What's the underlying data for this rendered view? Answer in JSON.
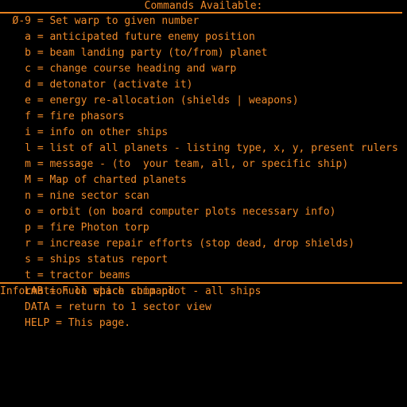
{
  "screen": {
    "title": "Commands Available:",
    "background_color": "#000000",
    "text_color": "#f08a2a",
    "rule_color": "#e8821f"
  },
  "commands": [
    {
      "key": "Ø-9",
      "sep": " = ",
      "desc": "Set warp to given number",
      "wide": false
    },
    {
      "key": "a",
      "sep": " = ",
      "desc": "anticipated future enemy position",
      "wide": false
    },
    {
      "key": "b",
      "sep": " = ",
      "desc": "beam landing party (to/from) planet",
      "wide": false
    },
    {
      "key": "c",
      "sep": " = ",
      "desc": "change course heading and warp",
      "wide": false
    },
    {
      "key": "d",
      "sep": " = ",
      "desc": "detonator (activate it)",
      "wide": false
    },
    {
      "key": "e",
      "sep": " = ",
      "desc": "energy re-allocation (shields | weapons)",
      "wide": false
    },
    {
      "key": "f",
      "sep": " = ",
      "desc": "fire phasors",
      "wide": false
    },
    {
      "key": "i",
      "sep": " = ",
      "desc": "info on other ships",
      "wide": false
    },
    {
      "key": "l",
      "sep": " = ",
      "desc": "list of all planets - listing type, x, y, present rulers",
      "wide": false
    },
    {
      "key": "m",
      "sep": " = ",
      "desc": "message - (to  your team, all, or specific ship)",
      "wide": false
    },
    {
      "key": "M",
      "sep": " = ",
      "desc": "Map of charted planets",
      "wide": false
    },
    {
      "key": "n",
      "sep": " = ",
      "desc": "nine sector scan",
      "wide": false
    },
    {
      "key": "o",
      "sep": " = ",
      "desc": "orbit (on board computer plots necessary info)",
      "wide": false
    },
    {
      "key": "p",
      "sep": " = ",
      "desc": "fire Photon torp",
      "wide": false
    },
    {
      "key": "r",
      "sep": " = ",
      "desc": "increase repair efforts (stop dead, drop shields)",
      "wide": false
    },
    {
      "key": "s",
      "sep": " = ",
      "desc": "ships status report",
      "wide": false
    },
    {
      "key": "t",
      "sep": " = ",
      "desc": "tractor beams",
      "wide": false
    },
    {
      "key": "LAB",
      "sep": " = ",
      "desc": "Full space ship plot - all ships",
      "wide": true
    },
    {
      "key": "DATA",
      "sep": " = ",
      "desc": "return to 1 sector view",
      "wide": true
    },
    {
      "key": "HELP",
      "sep": " = ",
      "desc": "This page.",
      "wide": true
    }
  ],
  "prompt": {
    "text": "Information on which command"
  }
}
